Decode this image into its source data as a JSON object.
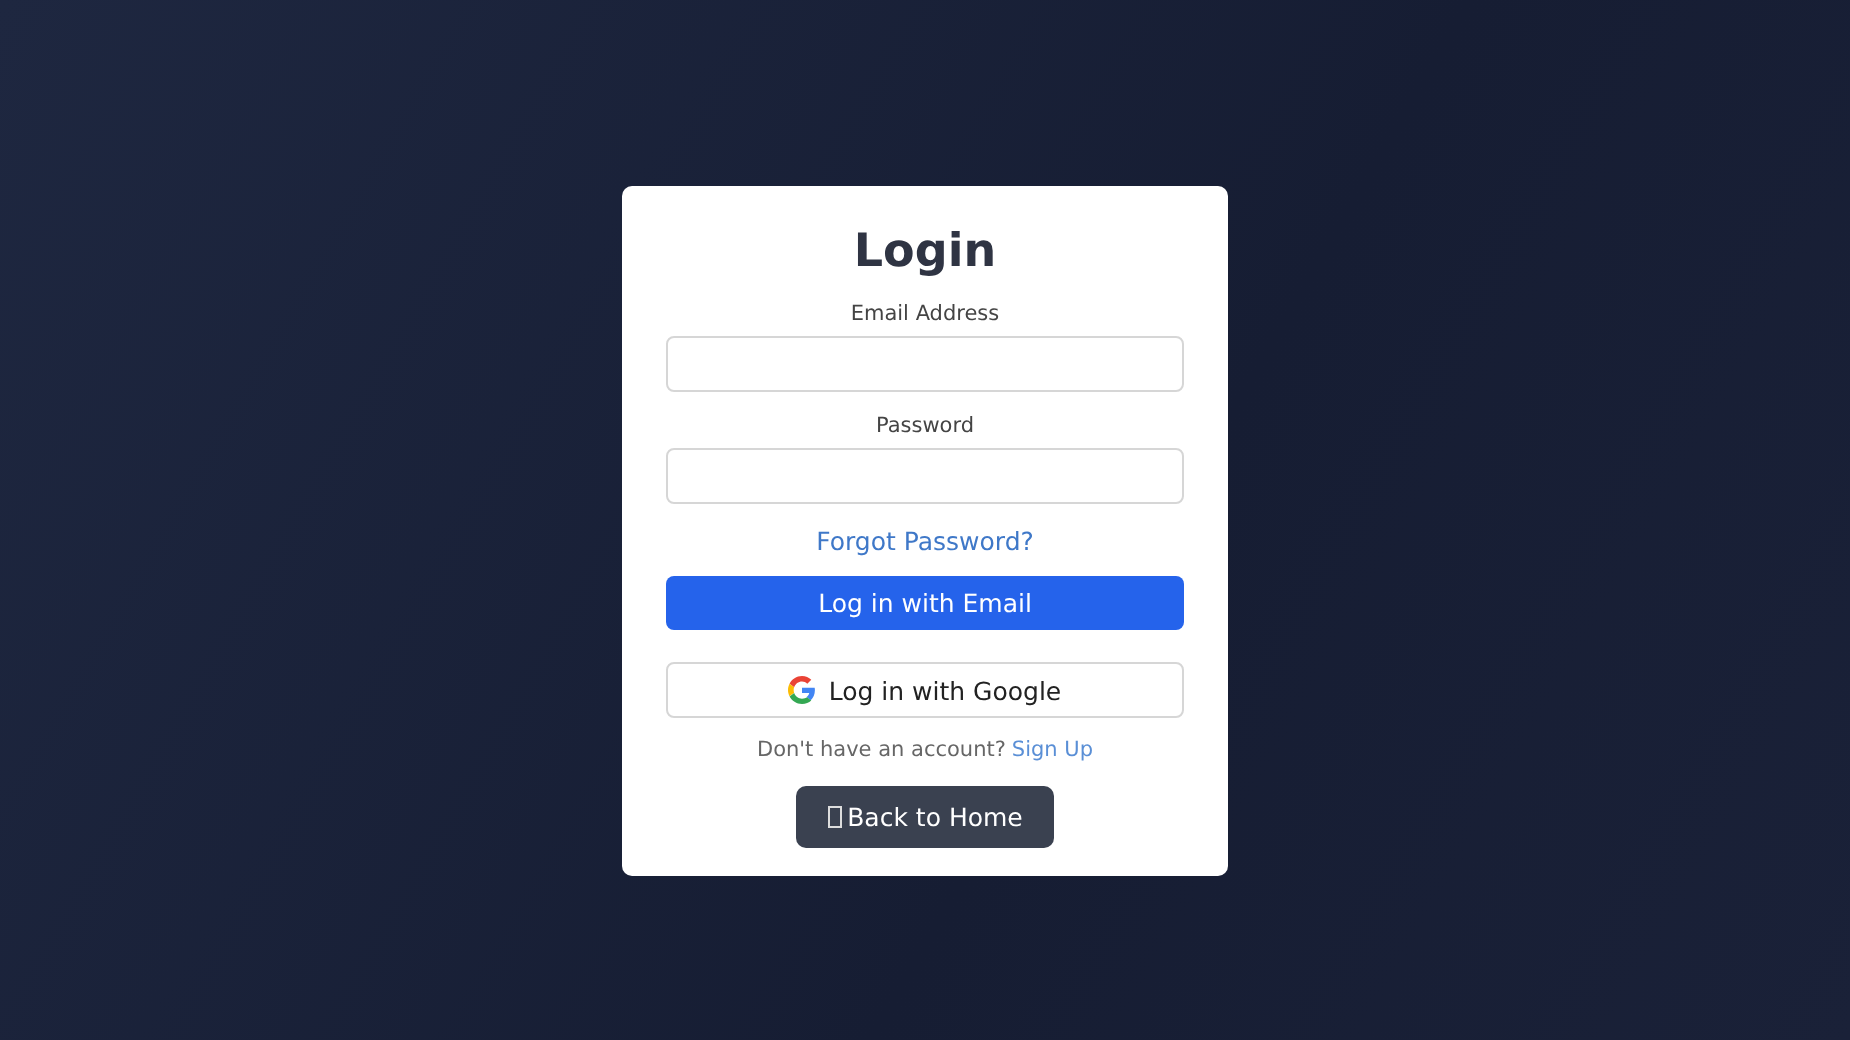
{
  "title": "Login",
  "fields": [
    {
      "label": "Email Address"
    },
    {
      "label": "Password"
    }
  ],
  "forgot_link": "Forgot Password?",
  "email_button": "Log in with Email",
  "google_button": "Log in with Google",
  "signup": {
    "text": "Don't have an account?",
    "link": "Sign Up"
  },
  "home_button": "Back to Home"
}
